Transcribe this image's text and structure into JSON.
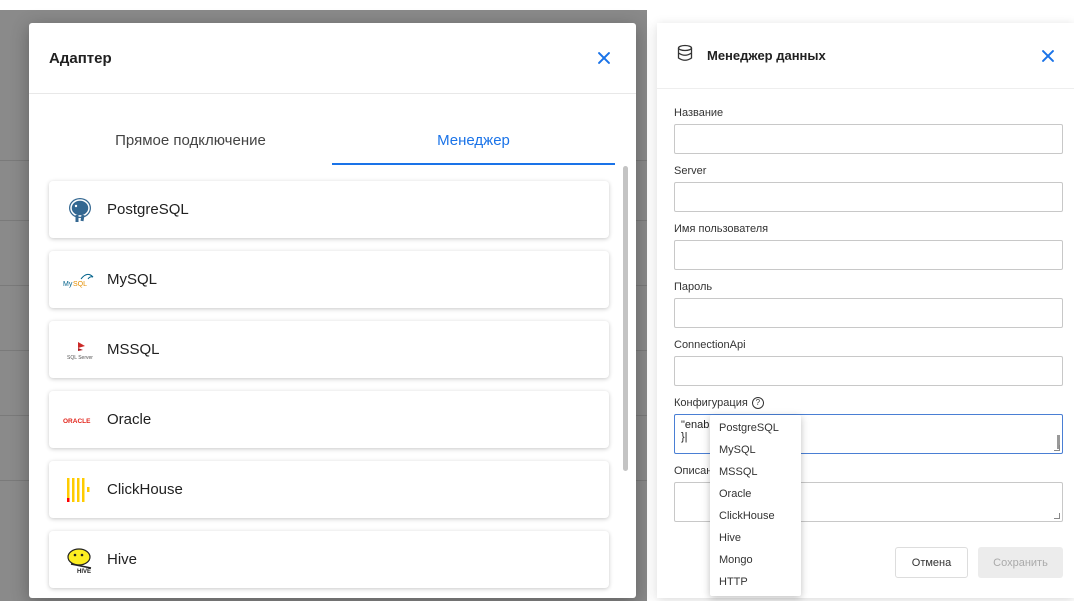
{
  "adapter_modal": {
    "title": "Адаптер",
    "tabs": [
      {
        "label": "Прямое подключение",
        "active": false
      },
      {
        "label": "Менеджер",
        "active": true
      }
    ],
    "databases": [
      {
        "name": "PostgreSQL",
        "icon": "postgresql-logo-icon"
      },
      {
        "name": "MySQL",
        "icon": "mysql-logo-icon"
      },
      {
        "name": "MSSQL",
        "icon": "sqlserver-logo-icon"
      },
      {
        "name": "Oracle",
        "icon": "oracle-logo-icon"
      },
      {
        "name": "ClickHouse",
        "icon": "clickhouse-logo-icon"
      },
      {
        "name": "Hive",
        "icon": "hive-logo-icon"
      }
    ],
    "accent_color": "#1a73e8"
  },
  "data_manager": {
    "title": "Менеджер данных",
    "fields": {
      "name_label": "Название",
      "server_label": "Server",
      "username_label": "Имя пользователя",
      "password_label": "Пароль",
      "connection_api_label": "ConnectionApi",
      "config_label": "Конфигурация",
      "config_value_line1": "\"enab",
      "config_value_line2": "}|",
      "description_label": "Описан"
    },
    "buttons": {
      "cancel": "Отмена",
      "save": "Сохранить"
    }
  },
  "dropdown_options": [
    "PostgreSQL",
    "MySQL",
    "MSSQL",
    "Oracle",
    "ClickHouse",
    "Hive",
    "Mongo",
    "HTTP"
  ]
}
